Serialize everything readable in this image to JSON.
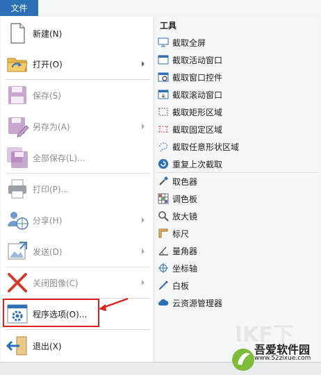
{
  "menubar": {
    "file_tab": "文件"
  },
  "left_menu": {
    "new": "新建(N)",
    "open": "打开(O)",
    "save": "保存(S)",
    "save_as": "另存为(A)",
    "save_all": "全部保存(L)...",
    "print": "打印(P)...",
    "share": "分享(H)",
    "send": "发送(D)",
    "close_image": "关闭图像(C)",
    "program_options": "程序选项(O)...",
    "exit": "退出(X)"
  },
  "tools": {
    "header": "工具",
    "items": [
      {
        "label": "截取全屏",
        "icon": "monitor-icon"
      },
      {
        "label": "截取活动窗口",
        "icon": "window-icon"
      },
      {
        "label": "截取窗口控件",
        "icon": "window-control-icon"
      },
      {
        "label": "截取滚动窗口",
        "icon": "scroll-window-icon"
      },
      {
        "label": "截取矩形区域",
        "icon": "rectangle-region-icon"
      },
      {
        "label": "截取固定区域",
        "icon": "fixed-region-icon"
      },
      {
        "label": "截取任意形状区域",
        "icon": "freeform-region-icon"
      },
      {
        "label": "重复上次截取",
        "icon": "repeat-icon"
      },
      {
        "label": "取色器",
        "icon": "eyedropper-icon"
      },
      {
        "label": "调色板",
        "icon": "palette-icon"
      },
      {
        "label": "放大镜",
        "icon": "magnifier-icon"
      },
      {
        "label": "标尺",
        "icon": "ruler-icon"
      },
      {
        "label": "量角器",
        "icon": "protractor-icon"
      },
      {
        "label": "坐标轴",
        "icon": "crosshair-icon"
      },
      {
        "label": "白板",
        "icon": "whiteboard-icon"
      },
      {
        "label": "云资源管理器",
        "icon": "cloud-icon"
      }
    ]
  },
  "watermark": {
    "brand": "吾爱软件园",
    "site": "www.52zixue.com"
  },
  "colors": {
    "accent": "#2b6fb6",
    "highlight": "#e02020",
    "disabled_text": "#8c8c8c"
  }
}
